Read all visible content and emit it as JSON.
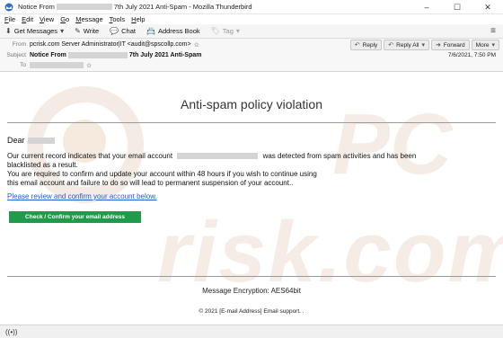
{
  "window": {
    "title_prefix": "Notice From",
    "title_suffix": "7th July 2021 Anti-Spam - Mozilla Thunderbird"
  },
  "window_controls": {
    "minimize": "–",
    "maximize": "☐",
    "close": "✕"
  },
  "menubar": {
    "file": {
      "u": "F",
      "rest": "ile"
    },
    "edit": {
      "u": "E",
      "rest": "dit"
    },
    "view": {
      "u": "V",
      "rest": "iew"
    },
    "go": {
      "u": "G",
      "rest": "o"
    },
    "message": {
      "u": "M",
      "rest": "essage"
    },
    "tools": {
      "u": "T",
      "rest": "ools"
    },
    "help": {
      "u": "H",
      "rest": "elp"
    }
  },
  "toolbar": {
    "get_messages": "Get Messages",
    "write": "Write",
    "chat": "Chat",
    "address_book": "Address Book",
    "tag": "Tag"
  },
  "header": {
    "from_label": "From",
    "from_value": "pcrisk.com Server Administrator|IT <audit@spscollp.com>",
    "subject_label": "Subject",
    "subject_prefix": "Notice From",
    "subject_suffix": "7th July 2021 Anti-Spam",
    "to_label": "To",
    "date": "7/6/2021, 7:50 PM",
    "reply": "Reply",
    "reply_all": "Reply All",
    "forward": "Forward",
    "more": "More"
  },
  "message": {
    "headline": "Anti-spam policy violation",
    "greeting": "Dear",
    "para_line1_a": "Our current record indicates that your email account",
    "para_line1_b": "was detected from spam activities and has been",
    "para_line2": "blacklisted as a result.",
    "para_line3": "You are required to confirm and update your account within 48 hours if you wish to continue using",
    "para_line4": "this email account and failure to do so will lead to permanent suspension of your account..",
    "link": "Please review and confirm your account below.",
    "button": "Check / Confirm your email address",
    "encryption": "Message Encryption: AES64bit",
    "copyright": "© 2021 [E-mail Address] Email support. ."
  },
  "watermark": {
    "pc": "PC",
    "risk": "risk.com"
  },
  "icons": {
    "status": "((•))"
  },
  "colors": {
    "cta": "#1f9b4b",
    "link": "#1a5fd6"
  }
}
